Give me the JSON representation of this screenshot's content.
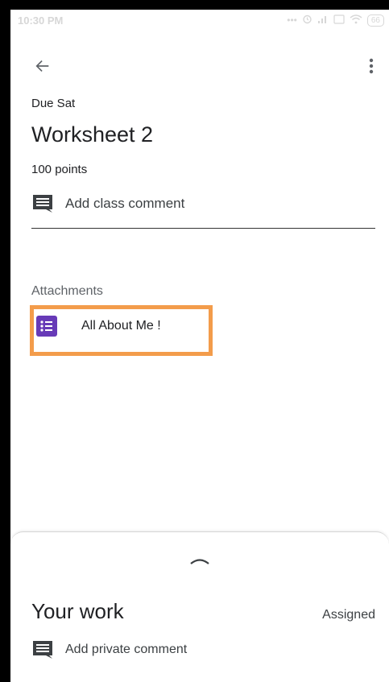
{
  "status_bar": {
    "time": "10:30 PM",
    "icons": [
      "dots-icon",
      "alarm-icon",
      "signal-icon",
      "volte-icon",
      "wifi-icon"
    ],
    "battery": "66"
  },
  "assignment": {
    "due": "Due Sat",
    "title": "Worksheet 2",
    "points": "100 points",
    "class_comment_label": "Add class comment"
  },
  "attachments": {
    "heading": "Attachments",
    "items": [
      {
        "title": "All About Me !",
        "icon": "google-forms-icon",
        "icon_color": "#673ab7"
      }
    ],
    "highlight_color": "#f39c4b"
  },
  "your_work": {
    "title": "Your work",
    "status": "Assigned",
    "private_comment_label": "Add private comment"
  }
}
